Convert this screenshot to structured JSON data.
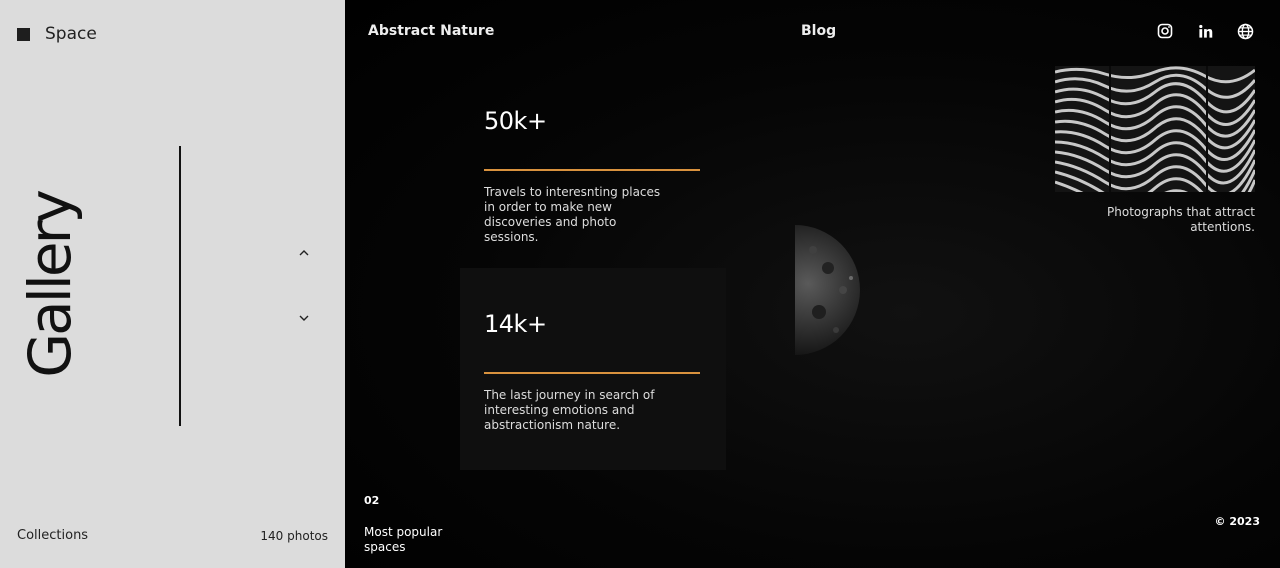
{
  "sidebar": {
    "brand": "Space",
    "title": "Gallery",
    "collections_label": "Collections",
    "photo_count": "140 photos"
  },
  "header": {
    "left_link": "Abstract Nature",
    "center_link": "Blog",
    "social_icons": [
      "instagram-icon",
      "linkedin-icon",
      "globe-icon"
    ]
  },
  "stats": [
    {
      "value": "50k+",
      "description": "Travels to interesnting places in order to make new discoveries and photo sessions."
    },
    {
      "value": "14k+",
      "description": "The last journey in search of interesting emotions and abstractionism nature."
    }
  ],
  "feature": {
    "caption": "Photographs that attract attentions."
  },
  "footer": {
    "page_number": "02",
    "section_label": "Most popular spaces",
    "copyright": "© 2023"
  },
  "colors": {
    "sidebar_bg": "#dcdcdc",
    "main_bg": "#000000",
    "accent": "#d9923e"
  }
}
